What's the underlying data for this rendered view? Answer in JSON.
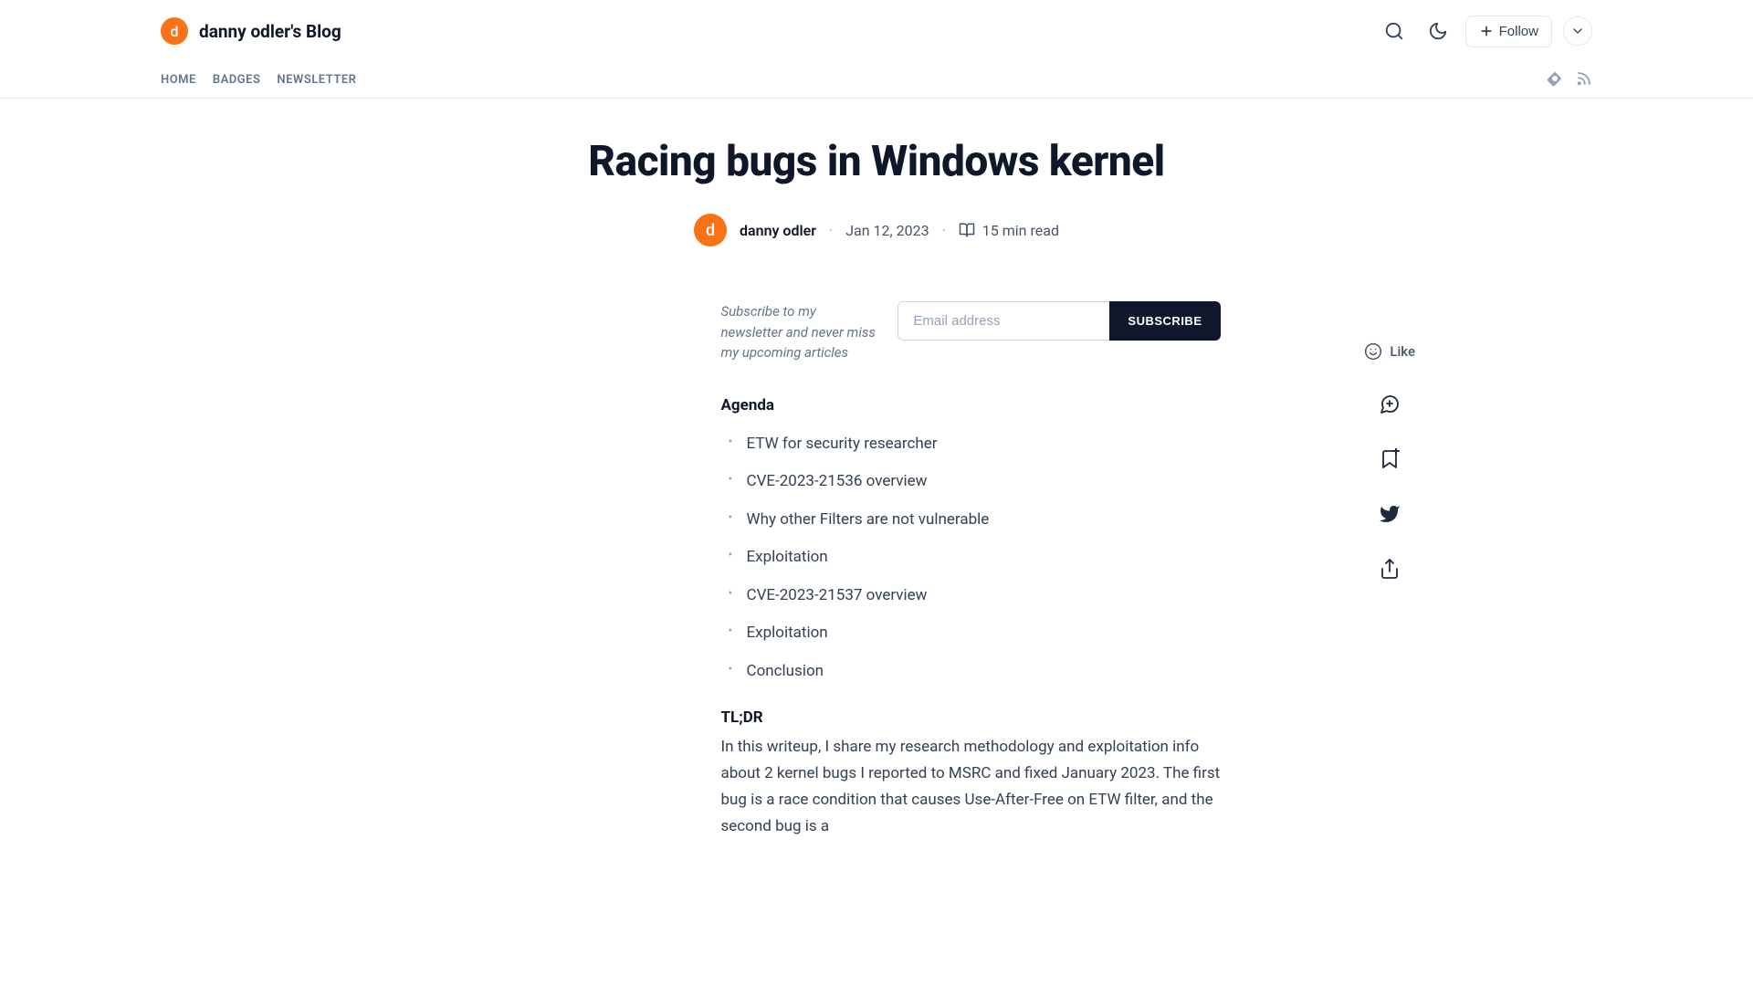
{
  "header": {
    "avatar_letter": "d",
    "blog_title": "danny odler's Blog",
    "follow_label": "Follow"
  },
  "nav": {
    "items": [
      "HOME",
      "BADGES",
      "NEWSLETTER"
    ]
  },
  "article": {
    "title": "Racing bugs in Windows kernel",
    "author_avatar_letter": "d",
    "author": "danny odler",
    "date": "Jan 12, 2023",
    "reading_time": "15 min read"
  },
  "subscribe": {
    "prompt": "Subscribe to my newsletter and never miss my upcoming articles",
    "placeholder": "Email address",
    "button_label": "SUBSCRIBE"
  },
  "agenda": {
    "heading": "Agenda",
    "items": [
      "ETW for security researcher",
      "CVE-2023-21536 overview",
      "Why other Filters are not vulnerable",
      "Exploitation",
      "CVE-2023-21537 overview",
      "Exploitation",
      "Conclusion"
    ]
  },
  "tldr": {
    "heading": "TL;DR",
    "body": "In this writeup, I share my research methodology and exploitation info about 2 kernel bugs I reported to MSRC and fixed January 2023. The first bug is a race condition that causes Use-After-Free on ETW filter, and the second bug is a"
  },
  "side": {
    "like_label": "Like"
  }
}
